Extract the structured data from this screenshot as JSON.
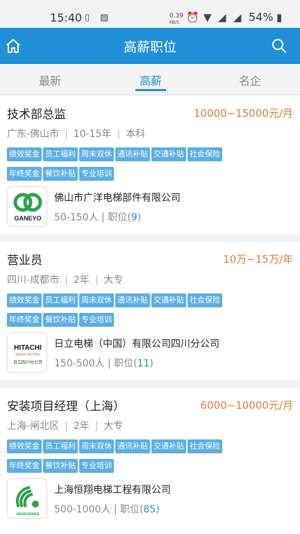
{
  "status_bar": {
    "time": "15:40",
    "speed": "0.39",
    "speed_unit": "KB/S",
    "battery": "54%"
  },
  "header": {
    "title": "高薪职位"
  },
  "tabs": [
    {
      "label": "最新"
    },
    {
      "label": "高薪"
    },
    {
      "label": "名企"
    }
  ],
  "jobs": [
    {
      "title": "技术部总监",
      "salary": "10000~15000元/月",
      "location": "广东-佛山市",
      "experience": "10-15年",
      "education": "本科",
      "tags": [
        "绩效奖金",
        "员工福利",
        "周末双休",
        "通讯补贴",
        "交通补贴",
        "社会保险",
        "年终奖金",
        "餐饮补贴",
        "专业培训"
      ],
      "company": "佛山市广洋电梯部件有限公司",
      "company_size": "50-150人",
      "positions_label": "职位",
      "positions_count": "9",
      "logo_text": "GANEYO"
    },
    {
      "title": "营业员",
      "salary": "10万~15万/年",
      "location": "四川-成都市",
      "experience": "2年",
      "education": "大专",
      "tags": [
        "绩效奖金",
        "员工福利",
        "周末双休",
        "通讯补贴",
        "交通补贴",
        "社会保险",
        "年终奖金",
        "餐饮补贴",
        "专业培训"
      ],
      "company": "日立电梯（中国）有限公司四川分公司",
      "company_size": "150-500人",
      "positions_label": "职位",
      "positions_count": "11",
      "logo_text": "HITACHI",
      "logo_sub": "Inspire the Next",
      "logo_cn": "日立四川分公司"
    },
    {
      "title": "安装项目经理（上海）",
      "salary": "6000~10000元/月",
      "location": "上海-闸北区",
      "experience": "2年",
      "education": "大专",
      "tags": [
        "绩效奖金",
        "员工福利",
        "周末双休",
        "通讯补贴",
        "交通补贴",
        "社会保险",
        "年终奖金",
        "餐饮补贴",
        "专业培训"
      ],
      "company": "上海恒翔电梯工程有限公司",
      "company_size": "500-1000人",
      "positions_label": "职位",
      "positions_count": "85",
      "logo_text": "HENGXIANG"
    }
  ],
  "colors": {
    "primary": "#1f8fd8",
    "salary": "#e07a3a",
    "tag_bg": "#5aaee6"
  }
}
